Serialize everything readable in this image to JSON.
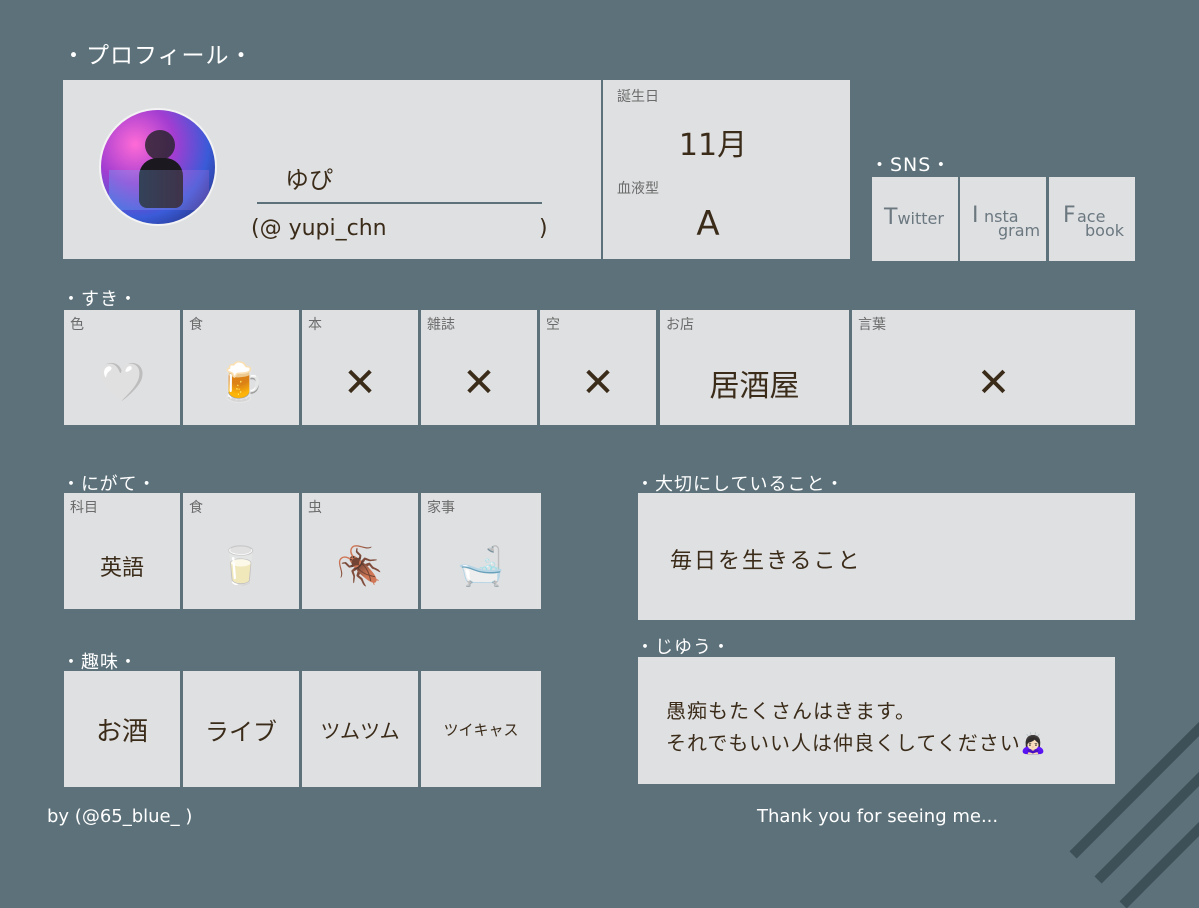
{
  "profile": {
    "heading": "・プロフィール・",
    "name": "ゆぴ",
    "handle_open": "(@ yupi_chn",
    "handle_close": ")",
    "birthday_label": "誕生日",
    "birthday_value": "11月",
    "blood_label": "血液型",
    "blood_value": "A"
  },
  "sns": {
    "heading": "・SNS・",
    "items": [
      {
        "big": "T",
        "small": "witter"
      },
      {
        "big": "I",
        "small_top": "nsta",
        "small_bottom": "gram"
      },
      {
        "big": "F",
        "small_top": "ace",
        "small_bottom": "book"
      }
    ]
  },
  "likes": {
    "heading": "・すき・",
    "items": [
      {
        "label": "色",
        "value": "🤍"
      },
      {
        "label": "食",
        "value": "🍺"
      },
      {
        "label": "本",
        "value": "✕"
      },
      {
        "label": "雑誌",
        "value": "✕"
      },
      {
        "label": "空",
        "value": "✕"
      },
      {
        "label": "お店",
        "value": "居酒屋"
      },
      {
        "label": "言葉",
        "value": "✕"
      }
    ]
  },
  "dislikes": {
    "heading": "・にがて・",
    "items": [
      {
        "label": "科目",
        "value": "英語"
      },
      {
        "label": "食",
        "value": "🥛"
      },
      {
        "label": "虫",
        "value": "🪳"
      },
      {
        "label": "家事",
        "value": "🛁"
      }
    ]
  },
  "hobbies": {
    "heading": "・趣味・",
    "items": [
      "お酒",
      "ライブ",
      "ツムツム",
      "ツイキャス"
    ]
  },
  "important": {
    "heading": "・大切にしていること・",
    "text": "毎日を生きること"
  },
  "freedom": {
    "heading": "・じゆう・",
    "line1": "愚痴もたくさんはきます。",
    "line2": "それでもいい人は仲良くしてください🙇🏻‍♀️"
  },
  "footer": {
    "credit": "by (@65_blue_ )",
    "thanks": "Thank you for seeing me..."
  }
}
